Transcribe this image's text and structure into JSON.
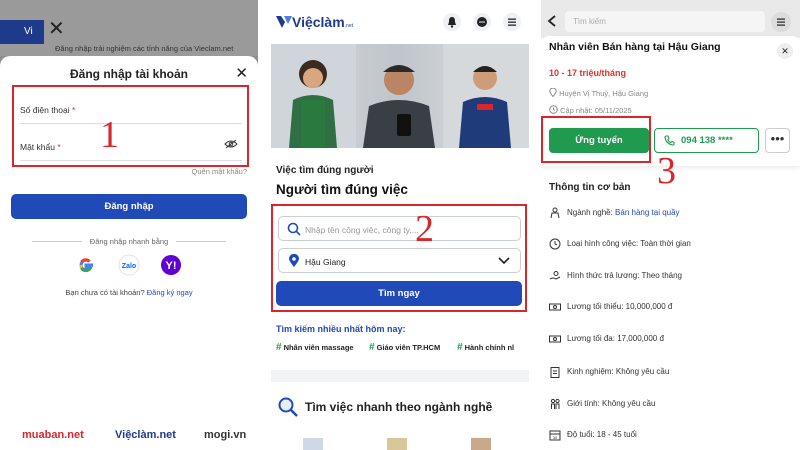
{
  "panel1": {
    "top_note": "Đăng nhập trải nghiệm các tính năng của Vieclam.net",
    "top_logo_partial": "Vi",
    "sheet_title": "Đăng nhập tài khoản",
    "phone_label": "Số điện thoại",
    "password_label": "Mật khẩu",
    "required_mark": "*",
    "forgot": "Quên mật khẩu?",
    "login_button": "Đăng nhập",
    "quick_login": "Đăng nhập nhanh bằng",
    "no_account": "Bạn chưa có tài khoản?",
    "register_link": "Đăng ký ngay",
    "social": [
      "Google",
      "Zalo",
      "Yahoo"
    ],
    "footer_logos": [
      "muaban.net",
      "Việclàm.net",
      "mogi.vn"
    ],
    "step_number": "1"
  },
  "panel2": {
    "logo": "Việclàm",
    "logo_suffix": ".net",
    "tagline_1": "Việc tìm đúng người",
    "tagline_2": "Người tìm đúng việc",
    "search_placeholder": "Nhập tên công việc, công ty,...",
    "location": "Hậu Giang",
    "find_button": "Tìm ngay",
    "trending_title": "Tìm kiếm nhiều nhất hôm nay:",
    "trending": [
      "Nhân viên massage",
      "Giáo viên TP.HCM",
      "Hành chính nl"
    ],
    "quick_title": "Tìm việc nhanh theo ngành nghề",
    "step_number": "2"
  },
  "panel3": {
    "search_placeholder": "Tìm kiếm",
    "job_title": "Nhân viên Bán hàng tại Hậu Giang",
    "salary": "10 - 17 triệu/tháng",
    "location": "Huyện Vị Thuỷ, Hậu Giang",
    "updated": "Cập nhật: 05/11/2025",
    "apply_button": "Ứng tuyển",
    "phone": "094 138 ****",
    "basic_title": "Thông tin cơ bản",
    "rows": [
      {
        "label": "Ngành nghề: ",
        "value": "Bán hàng tại quầy"
      },
      {
        "label": "Loại hình công việc: Toàn thời gian",
        "value": ""
      },
      {
        "label": "Hình thức trả lương: Theo tháng",
        "value": ""
      },
      {
        "label": "Lương tối thiểu: 10,000,000 đ",
        "value": ""
      },
      {
        "label": "Lương tối đa: 17,000,000 đ",
        "value": ""
      },
      {
        "label": "Kinh nghiệm: Không yêu cầu",
        "value": ""
      },
      {
        "label": "Giới tính: Không yêu cầu",
        "value": ""
      },
      {
        "label": "Độ tuổi: 18 - 45 tuổi",
        "value": ""
      }
    ],
    "step_number": "3"
  },
  "colors": {
    "brand_blue": "#1f4ab8",
    "apply_green": "#1f9a4f",
    "salary_red": "#e0322d",
    "highlight_red": "#d8262b"
  }
}
